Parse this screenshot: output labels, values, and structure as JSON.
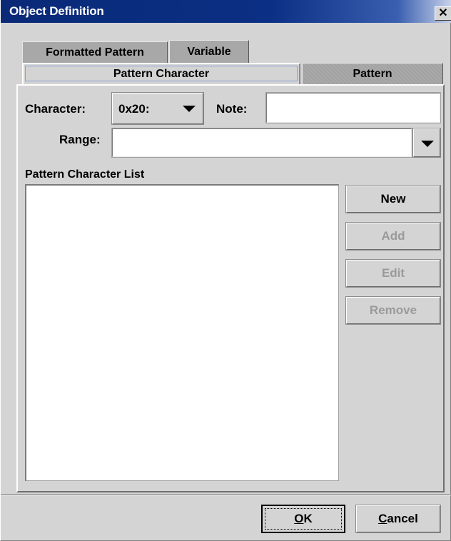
{
  "window": {
    "title": "Object Definition",
    "close_glyph": "✕"
  },
  "tabs": {
    "row_back": [
      {
        "label": "Formatted Pattern"
      },
      {
        "label": "Variable"
      }
    ],
    "row_front": [
      {
        "label": "Pattern Character",
        "selected": true
      },
      {
        "label": "Pattern",
        "selected": false
      }
    ]
  },
  "form": {
    "character_label": "Character:",
    "character_value": "0x20:",
    "note_label": "Note:",
    "note_value": "",
    "range_label": "Range:",
    "range_value": ""
  },
  "list": {
    "title": "Pattern Character List",
    "items": []
  },
  "side_buttons": {
    "new": {
      "label": "New",
      "enabled": true
    },
    "add": {
      "label": "Add",
      "enabled": false
    },
    "edit": {
      "label": "Edit",
      "enabled": false
    },
    "remove": {
      "label": "Remove",
      "enabled": false
    }
  },
  "dialog_buttons": {
    "ok": "OK",
    "ok_mnemonic": "O",
    "cancel": "Cancel",
    "cancel_mnemonic": "C"
  },
  "icons": {
    "close": "close-icon",
    "dropdown": "chevron-down-icon"
  }
}
